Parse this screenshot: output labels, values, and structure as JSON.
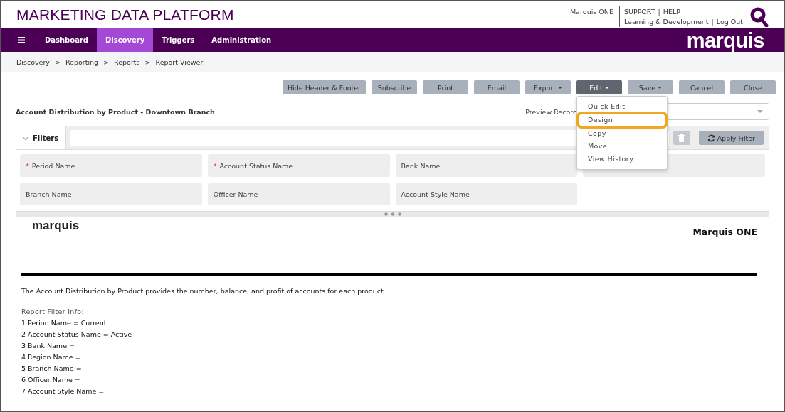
{
  "header": {
    "title": "MARKETING DATA PLATFORM",
    "user": "Marquis ONE",
    "separator": "|",
    "links": [
      [
        "SUPPORT",
        "HELP"
      ],
      [
        "Learning & Development",
        "Log Out"
      ]
    ]
  },
  "nav": {
    "tabs": [
      {
        "label": "Dashboard",
        "selected": false
      },
      {
        "label": "Discovery",
        "selected": true
      },
      {
        "label": "Triggers",
        "selected": false
      },
      {
        "label": "Administration",
        "selected": false
      }
    ],
    "logo": "marquis"
  },
  "breadcrumb": {
    "separator": ">",
    "items": [
      "Discovery",
      "Reporting",
      "Reports",
      "Report Viewer"
    ]
  },
  "toolbar": [
    {
      "label": "Hide Header & Footer",
      "caret": false,
      "active": false
    },
    {
      "label": "Subscribe",
      "caret": false,
      "active": false
    },
    {
      "label": "Print",
      "caret": false,
      "active": false
    },
    {
      "label": "Email",
      "caret": false,
      "active": false
    },
    {
      "label": "Export",
      "caret": true,
      "active": false
    },
    {
      "label": "Edit",
      "caret": true,
      "active": true
    },
    {
      "label": "Save",
      "caret": true,
      "active": false
    },
    {
      "label": "Cancel",
      "caret": false,
      "active": false
    },
    {
      "label": "Close",
      "caret": false,
      "active": false
    }
  ],
  "edit_menu": [
    {
      "label": "Quick Edit",
      "highlighted": false
    },
    {
      "label": "Design",
      "highlighted": true
    },
    {
      "label": "Copy",
      "highlighted": false
    },
    {
      "label": "Move",
      "highlighted": false
    },
    {
      "label": "View History",
      "highlighted": false
    }
  ],
  "report_title": "Account Distribution by Product - Downtown Branch",
  "preview_record": {
    "label": "Preview Record"
  },
  "filters": {
    "label": "Filters",
    "required_mark": "*",
    "expanded": true,
    "delete_disabled": true,
    "apply": "Apply Filter",
    "fields": [
      {
        "label": "Period Name",
        "required": true
      },
      {
        "label": "Account Status Name",
        "required": true
      },
      {
        "label": "Bank Name",
        "required": false
      },
      {
        "required": false
      },
      {
        "label": "Branch Name",
        "required": false
      },
      {
        "label": "Officer Name",
        "required": false
      },
      {
        "label": "Account Style Name",
        "required": false
      }
    ]
  },
  "report": {
    "logo": "marquis",
    "brand": "Marquis ONE",
    "description": "The Account Distribution by Product provides the number, balance, and profit of accounts for each product",
    "filter_info_heading": "Report Filter Info:",
    "filter_info": [
      "1 Period Name = Current",
      "2 Account Status Name = Active",
      "3 Bank Name =",
      "4 Region Name =",
      "5 Branch Name =",
      "6 Officer Name =",
      "7 Account Style Name ="
    ]
  }
}
